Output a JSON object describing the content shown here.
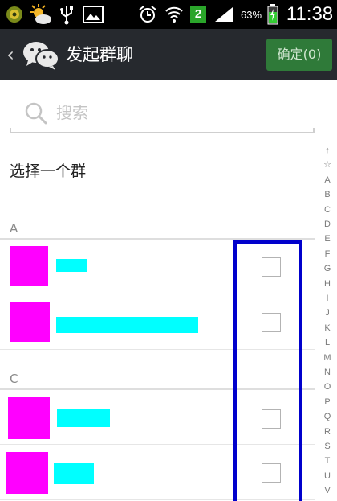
{
  "status_bar": {
    "battery_percent": "63%",
    "notification_count": "2",
    "time": "11:38",
    "icons": [
      "app-icon",
      "weather-icon",
      "usb-icon",
      "image-icon",
      "alarm-icon",
      "wifi-icon",
      "signal-icon",
      "battery-charging-icon"
    ]
  },
  "header": {
    "title": "发起群聊",
    "confirm_label": "确定(0)",
    "icons": [
      "back-arrow-icon",
      "wechat-icon"
    ]
  },
  "search": {
    "placeholder": "搜索"
  },
  "select_group": {
    "label": "选择一个群"
  },
  "sections": [
    {
      "letter": "A"
    },
    {
      "letter": "C"
    }
  ],
  "index_letters": [
    "↑",
    "☆",
    "A",
    "B",
    "C",
    "D",
    "E",
    "F",
    "G",
    "H",
    "I",
    "J",
    "K",
    "L",
    "M",
    "N",
    "O",
    "P",
    "Q",
    "R",
    "S",
    "T",
    "U",
    "V"
  ],
  "colors": {
    "header_bg": "#26292e",
    "confirm_bg": "#2f7a39",
    "avatar_redaction": "#ff00ff",
    "name_redaction": "#00ffff",
    "highlight": "#0000cc"
  }
}
